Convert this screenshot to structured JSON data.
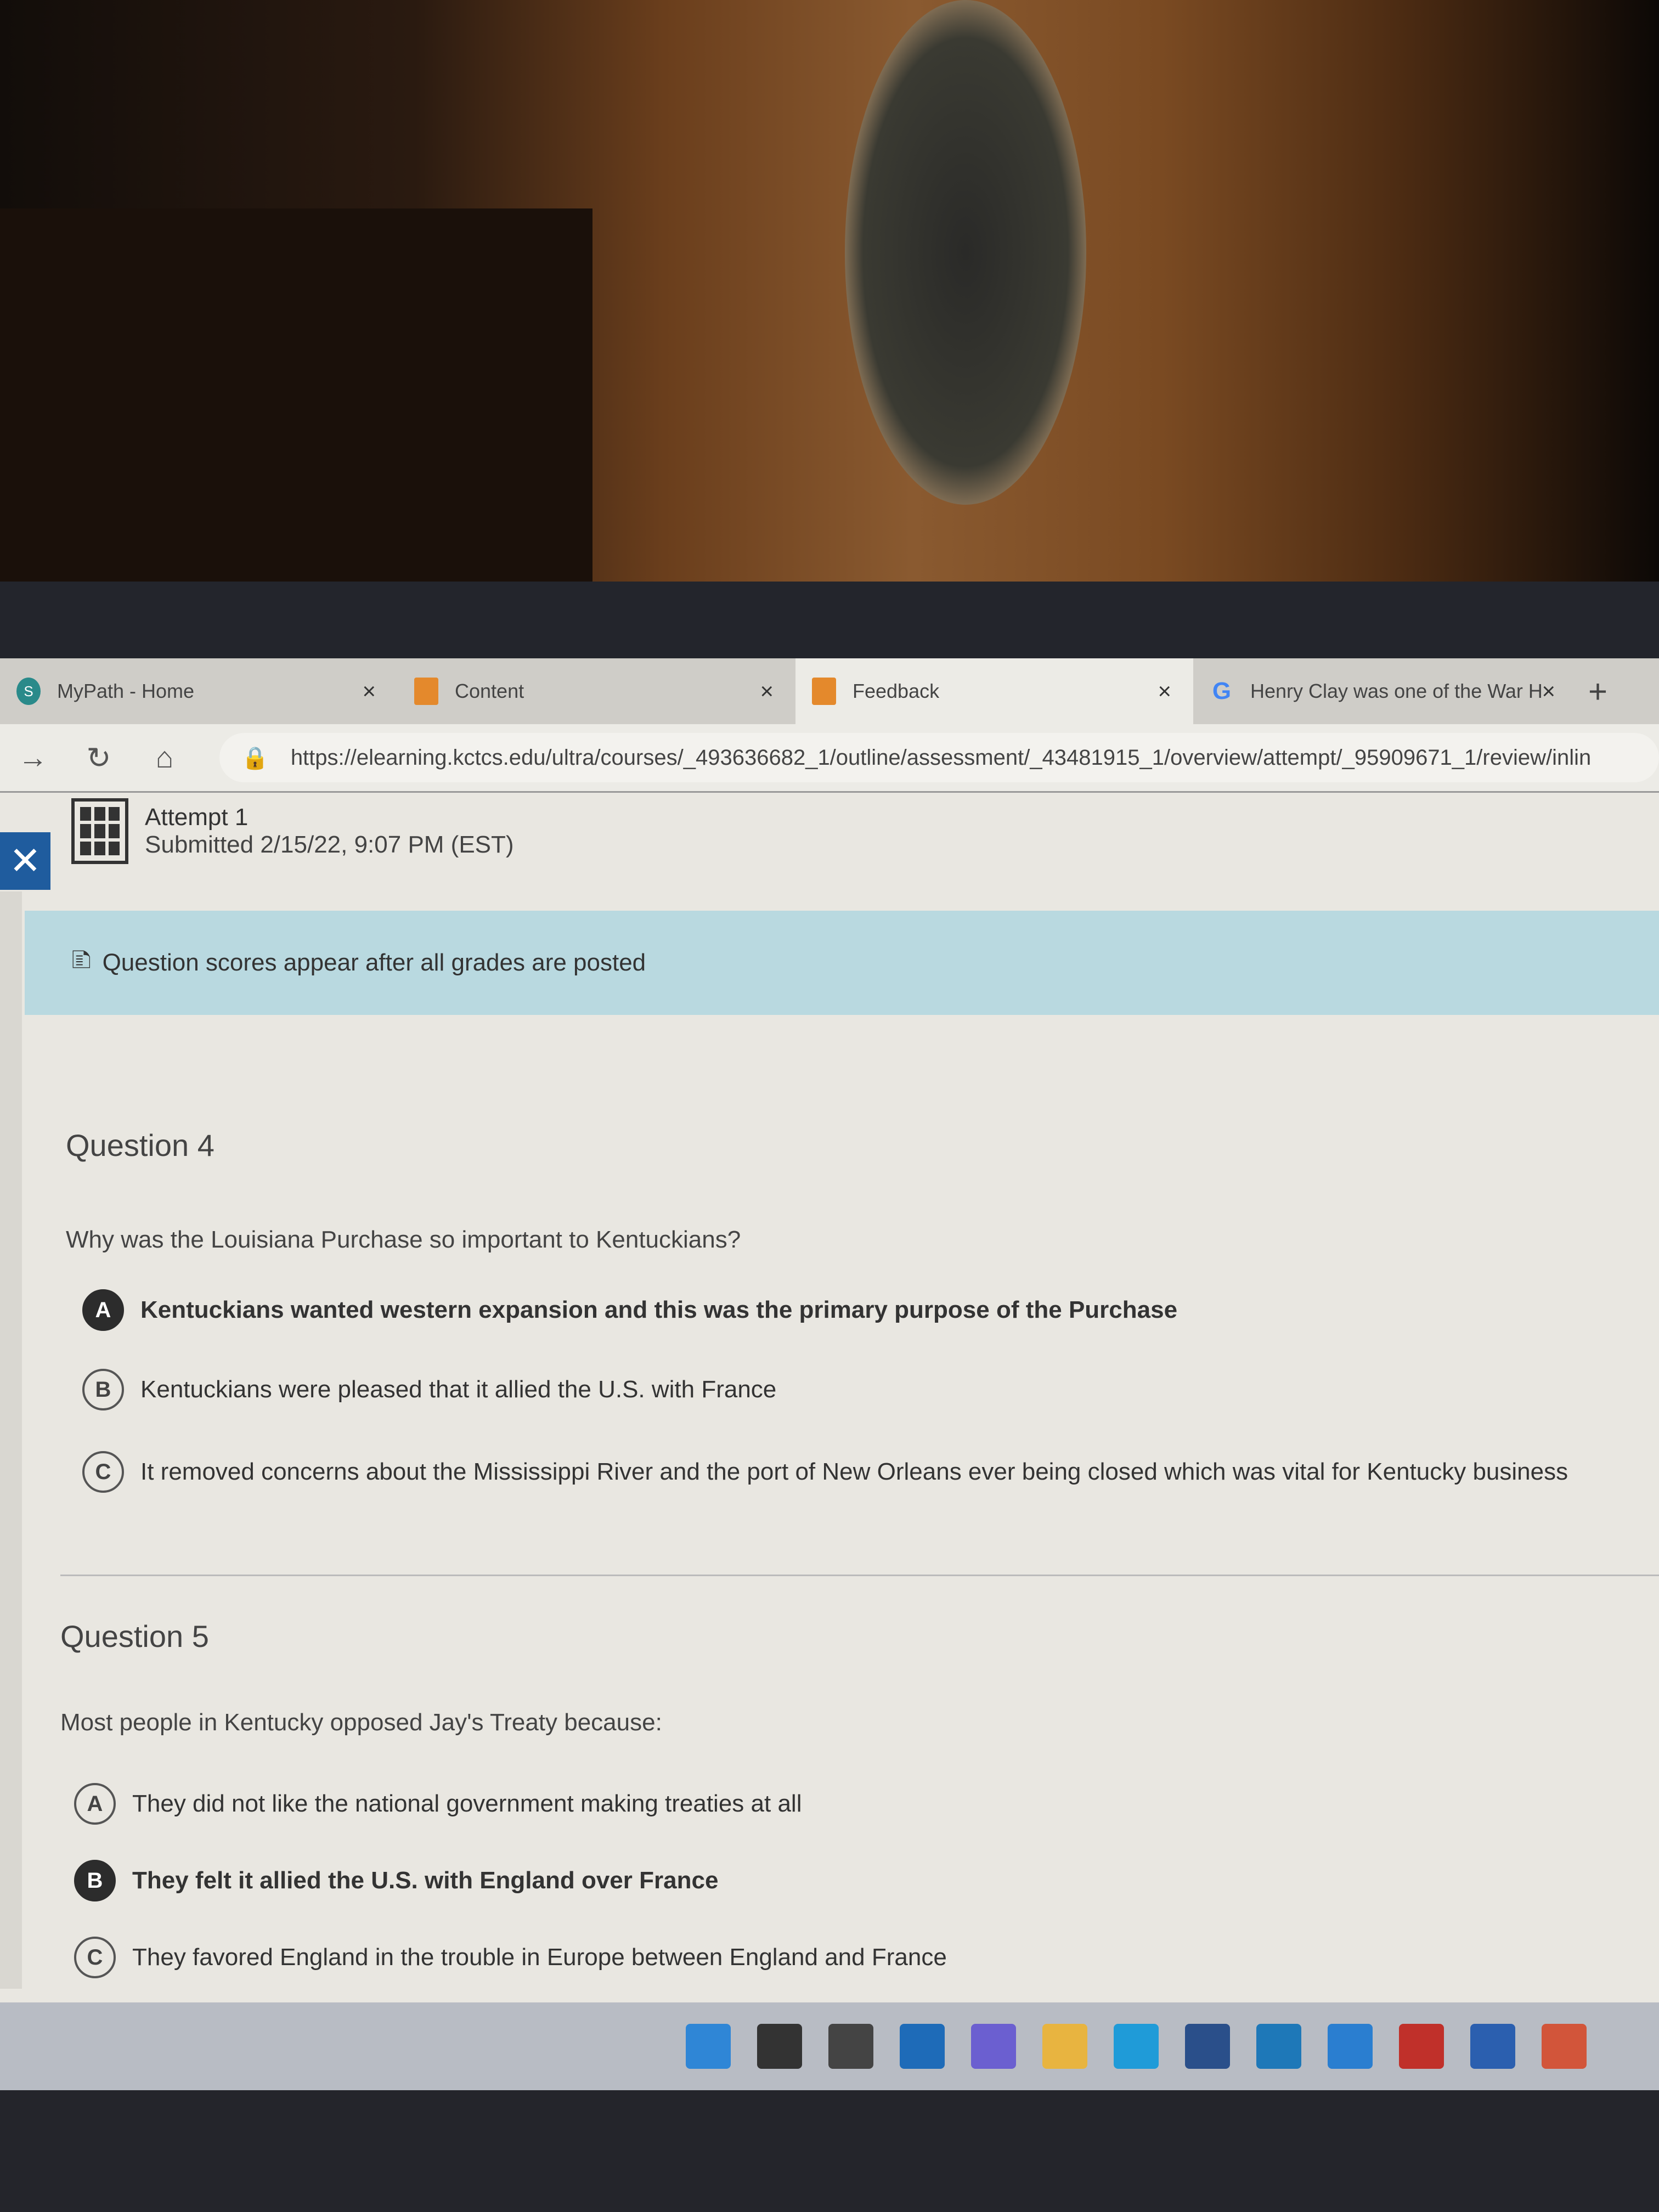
{
  "tabs": [
    {
      "label": "MyPath - Home",
      "icon": "sharepoint-icon",
      "active": false
    },
    {
      "label": "Content",
      "icon": "blackboard-icon",
      "active": false
    },
    {
      "label": "Feedback",
      "icon": "blackboard-icon",
      "active": true
    },
    {
      "label": "Henry Clay was one of the War H",
      "icon": "google-icon",
      "active": false
    }
  ],
  "new_tab": "+",
  "close_glyph": "×",
  "url": "https://elearning.kctcs.edu/ultra/courses/_493636682_1/outline/assessment/_43481915_1/overview/attempt/_95909671_1/review/inlin",
  "attempt": {
    "title": "Attempt 1",
    "submitted": "Submitted 2/15/22, 9:07 PM (EST)"
  },
  "banner": "Question scores appear after all grades are posted",
  "questions": [
    {
      "title": "Question 4",
      "text": "Why was the Louisiana Purchase so important to Kentuckians?",
      "options": [
        {
          "letter": "A",
          "text": "Kentuckians wanted western expansion and this was the primary purpose of the Purchase",
          "selected": true
        },
        {
          "letter": "B",
          "text": "Kentuckians were pleased that it allied the U.S. with France",
          "selected": false
        },
        {
          "letter": "C",
          "text": "It removed concerns about the Mississippi River and the port of New Orleans ever being closed which was vital for Kentucky business",
          "selected": false
        }
      ]
    },
    {
      "title": "Question 5",
      "text": "Most people in Kentucky opposed Jay's Treaty because:",
      "options": [
        {
          "letter": "A",
          "text": "They did not like the national government making treaties at all",
          "selected": false
        },
        {
          "letter": "B",
          "text": "They felt it allied the U.S. with England over France",
          "selected": true
        },
        {
          "letter": "C",
          "text": "They favored England in the trouble in Europe between England and France",
          "selected": false
        }
      ]
    }
  ],
  "taskbar": [
    {
      "icon": "windows-start-icon",
      "color": "#2f86d6"
    },
    {
      "icon": "search-icon",
      "color": "#333333"
    },
    {
      "icon": "task-view-icon",
      "color": "#444444"
    },
    {
      "icon": "widgets-icon",
      "color": "#1e6bb8"
    },
    {
      "icon": "teams-chat-icon",
      "color": "#6b5fd0"
    },
    {
      "icon": "file-explorer-icon",
      "color": "#e8b440"
    },
    {
      "icon": "edge-icon",
      "color": "#1f9bd8"
    },
    {
      "icon": "microsoft-store-icon",
      "color": "#2a4f8a"
    },
    {
      "icon": "dell-icon",
      "color": "#1e78b8"
    },
    {
      "icon": "alexa-icon",
      "color": "#2a7ed0"
    },
    {
      "icon": "mcafee-icon",
      "color": "#c0302a"
    },
    {
      "icon": "word-icon",
      "color": "#2b5faf"
    },
    {
      "icon": "powerpoint-icon",
      "color": "#d2553a"
    }
  ]
}
